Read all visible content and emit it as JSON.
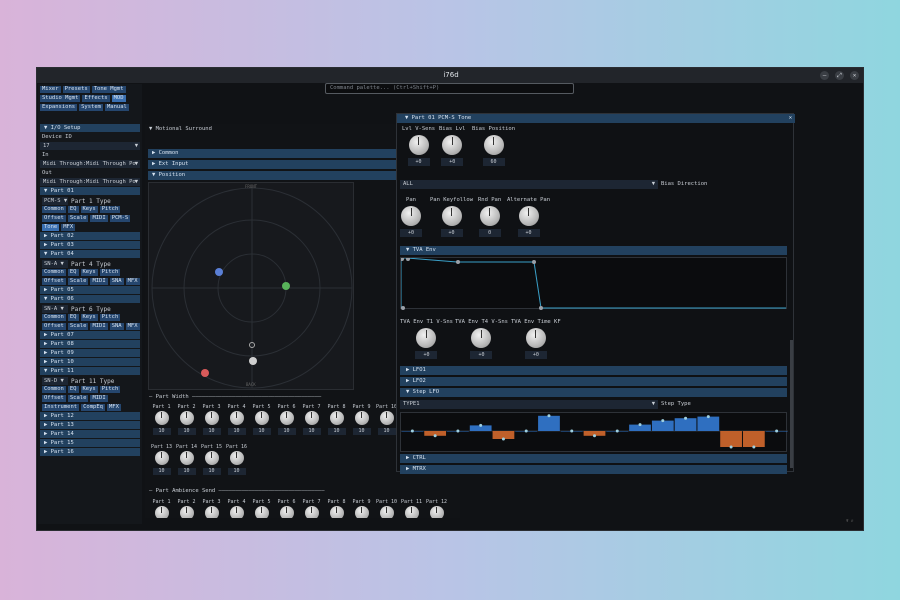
{
  "window": {
    "title": "i76d",
    "buttons": [
      "–",
      "⤢",
      "✕"
    ]
  },
  "command_palette": {
    "placeholder": "Command palette... (Ctrl+Shift+P)"
  },
  "menu": [
    {
      "label": "Mixer"
    },
    {
      "label": "Presets"
    },
    {
      "label": "Tone Mgmt"
    },
    {
      "label": "Studio Mgmt"
    },
    {
      "label": "Effects"
    },
    {
      "label": "MOD"
    },
    {
      "label": "Expansions"
    },
    {
      "label": "System"
    },
    {
      "label": "Manual"
    }
  ],
  "io_setup": {
    "header": "I/O Setup",
    "device_id_label": "Device ID",
    "device_id": "17",
    "in_label": "In",
    "in_value": "Midi Through:Midi Through Po",
    "out_label": "Out",
    "out_value": "Midi Through:Midi Through Po"
  },
  "parts": {
    "p1": "Part 01",
    "p1_type": "PCM-S",
    "p1_type_label": "Part 1 Type",
    "p2": "Part 02",
    "p3": "Part 03",
    "p4": "Part 04",
    "p4_type": "SN-A",
    "p4_type_label": "Part 4 Type",
    "p5": "Part 05",
    "p6": "Part 06",
    "p6_type": "SN-A",
    "p6_type_label": "Part 6 Type",
    "p7": "Part 07",
    "p8": "Part 08",
    "p9": "Part 09",
    "p10": "Part 10",
    "p11": "Part 11",
    "p11_type": "SN-D",
    "p11_type_label": "Part 11 Type",
    "p12": "Part 12",
    "p13": "Part 13",
    "p14": "Part 14",
    "p15": "Part 15",
    "p16": "Part 16"
  },
  "part_buttons": {
    "common": "Common",
    "eq": "EQ",
    "keys": "Keys",
    "pitch": "Pitch",
    "offset": "Offset",
    "scale": "Scale",
    "midi": "MIDI",
    "pcms": "PCM-S",
    "tone": "Tone",
    "mfx": "MFX",
    "sna": "SNA",
    "instrument": "Instrument",
    "compeq": "CompEq"
  },
  "motional": {
    "header": "Motional Surround",
    "common": "Common",
    "ext_input": "Ext Input",
    "position": "Position",
    "front": "FRONT",
    "back": "BACK",
    "part_width": "Part Width",
    "ambience": "Part Ambience Send"
  },
  "width_knobs": [
    {
      "label": "Part 1",
      "value": "10"
    },
    {
      "label": "Part 2",
      "value": "10"
    },
    {
      "label": "Part 3",
      "value": "10"
    },
    {
      "label": "Part 4",
      "value": "10"
    },
    {
      "label": "Part 5",
      "value": "10"
    },
    {
      "label": "Part 6",
      "value": "10"
    },
    {
      "label": "Part 7",
      "value": "10"
    },
    {
      "label": "Part 8",
      "value": "10"
    },
    {
      "label": "Part 9",
      "value": "10"
    },
    {
      "label": "Part 10",
      "value": "10"
    },
    {
      "label": "Part 13",
      "value": "10"
    },
    {
      "label": "Part 14",
      "value": "10"
    },
    {
      "label": "Part 15",
      "value": "10"
    },
    {
      "label": "Part 16",
      "value": "10"
    }
  ],
  "ambience_labels": [
    "Part 1",
    "Part 2",
    "Part 3",
    "Part 4",
    "Part 5",
    "Part 6",
    "Part 7",
    "Part 8",
    "Part 9",
    "Part 10",
    "Part 11",
    "Part 12"
  ],
  "tone": {
    "title": "Part 01 PCM-S Tone",
    "lvl_vsens": "Lvl V-Sens",
    "lvl_vsens_val": "+0",
    "bias_lvl": "Bias Lvl",
    "bias_lvl_val": "+0",
    "bias_pos": "Bias Position",
    "bias_pos_val": "60",
    "bias_dir_value": "ALL",
    "bias_dir_label": "Bias Direction",
    "pan": "Pan",
    "pan_val": "+0",
    "pan_kf": "Pan Keyfollow",
    "pan_kf_val": "+0",
    "rnd_pan": "Rnd Pan",
    "rnd_pan_val": "0",
    "alt_pan": "Alternate Pan",
    "alt_pan_val": "+0",
    "tva_env": "TVA Env",
    "t1": "TVA Env T1 V-Sns",
    "t1_val": "+0",
    "t4": "TVA Env T4 V-Sns",
    "t4_val": "+0",
    "tkf": "TVA Env Time KF",
    "tkf_val": "+0",
    "lfo1": "LFO1",
    "lfo2": "LFO2",
    "step_lfo": "Step LFO",
    "step_type_value": "TYPE1",
    "step_type_label": "Step Type",
    "ctrl": "CTRL",
    "mtrx": "MTRX"
  },
  "step_lfo_values": [
    0,
    -0.3,
    0,
    0.35,
    -0.5,
    0,
    0.95,
    0,
    -0.3,
    0,
    0.4,
    0.65,
    0.8,
    0.9,
    -1,
    -1,
    0
  ],
  "foot": "Ψ ∅"
}
